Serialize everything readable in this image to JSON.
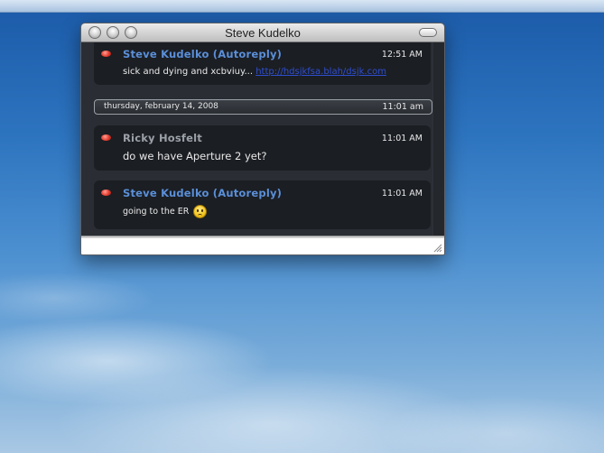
{
  "window": {
    "title": "Steve Kudelko"
  },
  "messages": [
    {
      "sender": "Steve Kudelko (Autoreply)",
      "time": "12:51 AM",
      "text": "sick and dying and xcbviuy...",
      "link": "http://hdsjkfsa.blah/dsjk.com"
    },
    {
      "sender": "Ricky Hosfelt",
      "time": "11:01 AM",
      "text": "do we have Aperture 2 yet?"
    },
    {
      "sender": "Steve Kudelko (Autoreply)",
      "time": "11:01 AM",
      "text": "going to the ER"
    }
  ],
  "date_separator": {
    "date": "thursday, february 14, 2008",
    "time": "11:01 am"
  },
  "input": {
    "value": ""
  },
  "icons": {
    "status": "status-away-icon",
    "emoticon": "frown-emoticon-icon",
    "resize": "resize-grip-icon"
  },
  "colors": {
    "autoreply_sender": "#5b8fd8",
    "sender": "#9ca1a8",
    "status_dot": "#e23a2c",
    "link": "#2f4fd0"
  }
}
